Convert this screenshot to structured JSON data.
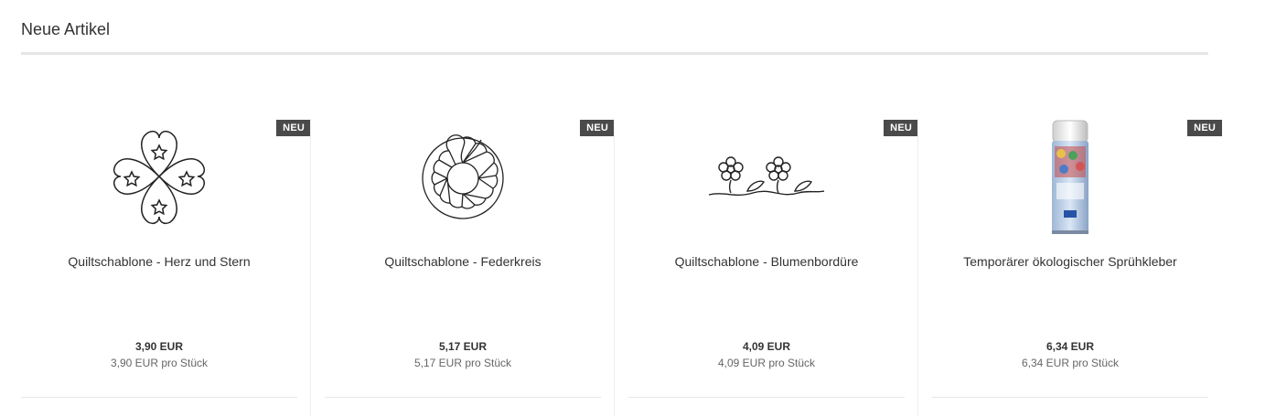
{
  "section": {
    "title": "Neue Artikel"
  },
  "products": [
    {
      "badge": "NEU",
      "name": "Quiltschablone - Herz und Stern",
      "price": "3,90 EUR",
      "unit_price": "3,90 EUR pro Stück",
      "image": "heart-star-quilt-stencil"
    },
    {
      "badge": "NEU",
      "name": "Quiltschablone - Federkreis",
      "price": "5,17 EUR",
      "unit_price": "5,17 EUR pro Stück",
      "image": "feather-circle-quilt-stencil"
    },
    {
      "badge": "NEU",
      "name": "Quiltschablone - Blumenbordüre",
      "price": "4,09 EUR",
      "unit_price": "4,09 EUR pro Stück",
      "image": "flower-border-quilt-stencil"
    },
    {
      "badge": "NEU",
      "name": "Temporärer ökologischer Sprühkleber",
      "price": "6,34 EUR",
      "unit_price": "6,34 EUR pro Stück",
      "image": "spray-can"
    }
  ]
}
